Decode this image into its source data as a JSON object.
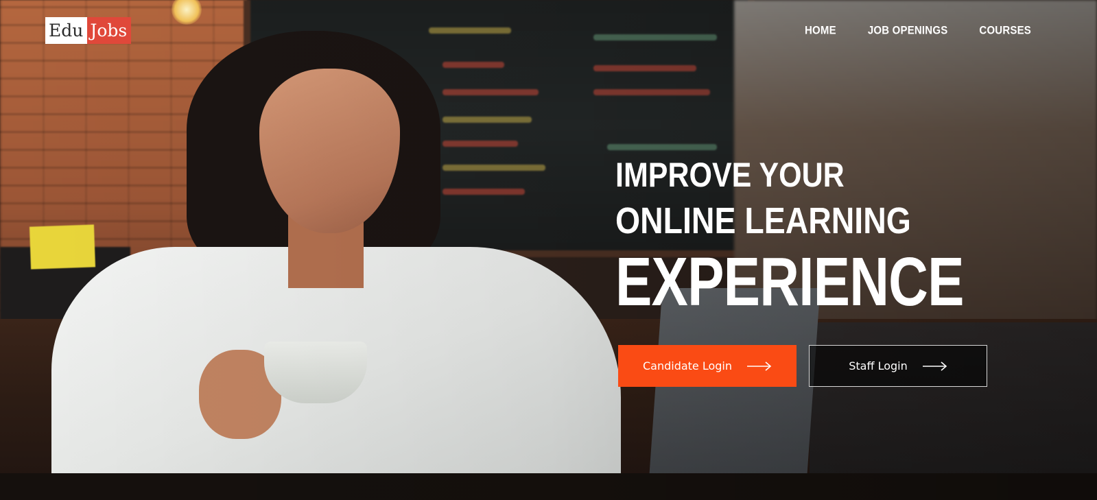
{
  "brand": {
    "part1": "Edu",
    "part2": "Jobs",
    "accent_color": "#e0483a"
  },
  "nav": {
    "items": [
      {
        "label": "HOME"
      },
      {
        "label": "JOB OPENINGS"
      },
      {
        "label": "COURSES"
      }
    ]
  },
  "hero": {
    "line1": "IMPROVE YOUR",
    "line2": "ONLINE LEARNING",
    "line3": "EXPERIENCE",
    "candidate_button": {
      "label": "Candidate Login",
      "icon": "arrow-right-icon",
      "color": "#fa4b14"
    },
    "staff_button": {
      "label": "Staff Login",
      "icon": "arrow-right-icon"
    }
  }
}
